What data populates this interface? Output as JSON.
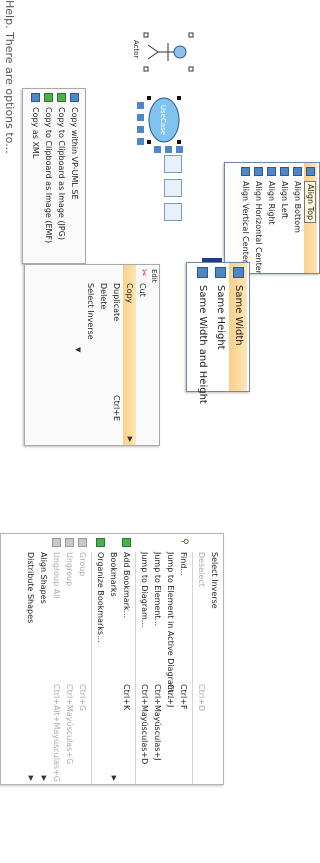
{
  "copy_menu": {
    "items": [
      {
        "label": "Copy within VP-UML SE",
        "icon": "copy-icon"
      },
      {
        "label": "Copy to Clipboard as Image (JPG)",
        "icon": "image-icon"
      },
      {
        "label": "Copy to Clipboard as Image (EMF)",
        "icon": "image-icon"
      },
      {
        "label": "Copy as XML",
        "icon": "xml-icon"
      }
    ]
  },
  "edit_menu": {
    "title": "Edit",
    "items": [
      {
        "label": "Cut",
        "shortcut": "",
        "icon": "scissors-icon",
        "state": "normal"
      },
      {
        "label": "Copy",
        "shortcut": "",
        "icon": "",
        "state": "highlighted"
      },
      {
        "label": "Duplicate",
        "shortcut": "Ctrl+E",
        "icon": "",
        "state": "normal"
      },
      {
        "label": "Delete",
        "shortcut": "",
        "icon": "",
        "state": "normal"
      },
      {
        "label": "Select Inverse",
        "shortcut": "",
        "icon": "",
        "state": "normal"
      }
    ]
  },
  "diagram": {
    "actor_label": "Actor",
    "usecase_label": "UseCase"
  },
  "align_menu": {
    "items": [
      {
        "label": "Align Top",
        "state": "highlighted"
      },
      {
        "label": "Align Bottom",
        "state": "normal"
      },
      {
        "label": "Align Left",
        "state": "normal"
      },
      {
        "label": "Align Right",
        "state": "normal"
      },
      {
        "label": "Align Horizontal Center",
        "state": "normal"
      },
      {
        "label": "Align Vertical Center",
        "state": "normal"
      }
    ]
  },
  "size_menu": {
    "items": [
      {
        "label": "Same Width",
        "state": "highlighted"
      },
      {
        "label": "Same Height",
        "state": "normal"
      },
      {
        "label": "Same Width and Height",
        "state": "normal"
      }
    ]
  },
  "context_menu": {
    "items": [
      {
        "label": "Select Inverse",
        "shortcut": "",
        "state": "normal",
        "icon": ""
      },
      {
        "label": "Deselect",
        "shortcut": "Ctrl+D",
        "state": "disabled",
        "icon": ""
      },
      {
        "label": "Find...",
        "shortcut": "Ctrl+F",
        "state": "normal",
        "icon": "binoculars-icon"
      },
      {
        "label": "Jump to Element in Active Diagram...",
        "shortcut": "Ctrl+J",
        "state": "normal",
        "icon": ""
      },
      {
        "label": "Jump to Element...",
        "shortcut": "Ctrl+Mayúsculas+J",
        "state": "normal",
        "icon": ""
      },
      {
        "label": "Jump to Diagram...",
        "shortcut": "Ctrl+Mayúsculas+D",
        "state": "normal",
        "icon": ""
      },
      {
        "label": "Add Bookmark...",
        "shortcut": "Ctrl+K",
        "state": "normal",
        "icon": "bookmark-add-icon"
      },
      {
        "label": "Bookmarks",
        "shortcut": "",
        "state": "normal",
        "icon": "",
        "submenu": true
      },
      {
        "label": "Organize Bookmarks...",
        "shortcut": "",
        "state": "normal",
        "icon": "bookmark-icon"
      },
      {
        "label": "Group",
        "shortcut": "Ctrl+G",
        "state": "disabled",
        "icon": "group-icon"
      },
      {
        "label": "Ungroup",
        "shortcut": "Ctrl+Mayúsculas+G",
        "state": "disabled",
        "icon": "ungroup-icon"
      },
      {
        "label": "Ungroup All",
        "shortcut": "Ctrl+Alt+Mayúsculas+G",
        "state": "disabled",
        "icon": "ungroup-all-icon"
      },
      {
        "label": "Align Shapes",
        "shortcut": "",
        "state": "normal",
        "icon": "",
        "submenu": true
      },
      {
        "label": "Distribute Shapes",
        "shortcut": "",
        "state": "normal",
        "icon": "",
        "submenu": true
      }
    ]
  },
  "caption": "Help.  There are options to..."
}
